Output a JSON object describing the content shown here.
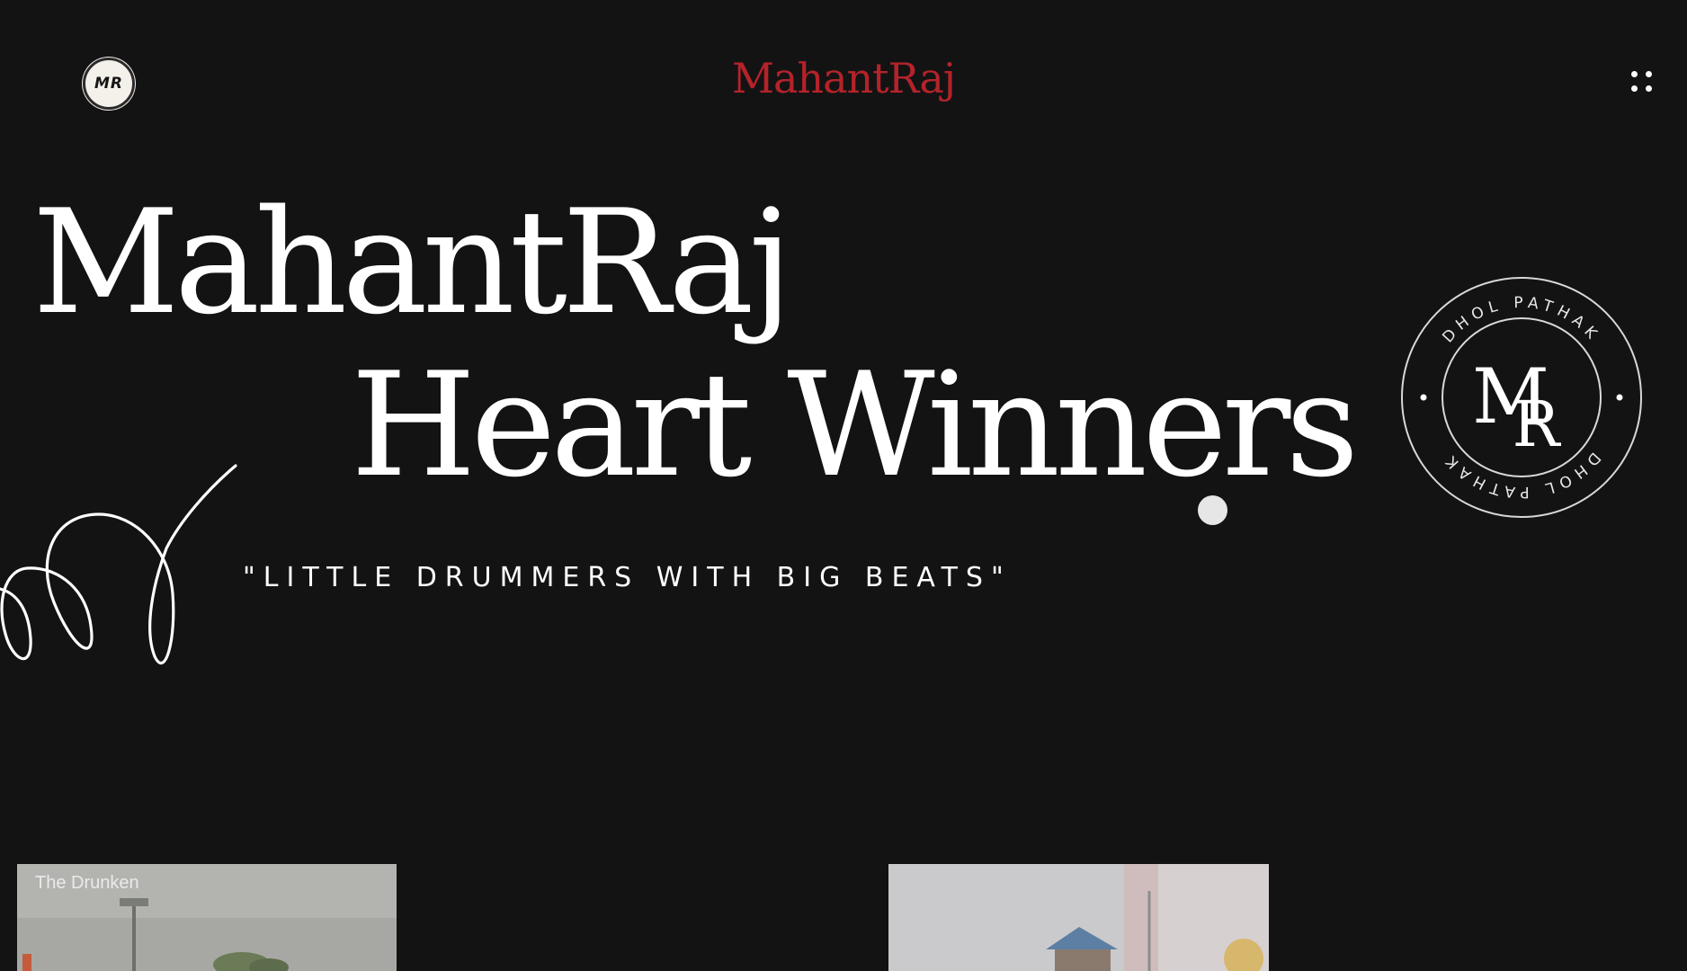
{
  "header": {
    "logo_badge_text": "MR",
    "brand": "MahantRaj",
    "menu_icon": "grid-dots-icon"
  },
  "hero": {
    "title_line1": "MahantRaj",
    "title_line2": "Heart Winners",
    "tagline": "\"LITTLE DRUMMERS WITH BIG BEATS\""
  },
  "stamp": {
    "ring_text_top": "DHOL PATHAK",
    "ring_text_bottom": "DHOL PATHAK",
    "monogram_left": "M",
    "monogram_right": "R"
  },
  "gallery": {
    "items": [
      {
        "caption": "The Drunken"
      },
      {
        "caption": ""
      }
    ]
  },
  "colors": {
    "background": "#131314",
    "brand_red": "#b4232a",
    "text": "#ffffff"
  }
}
